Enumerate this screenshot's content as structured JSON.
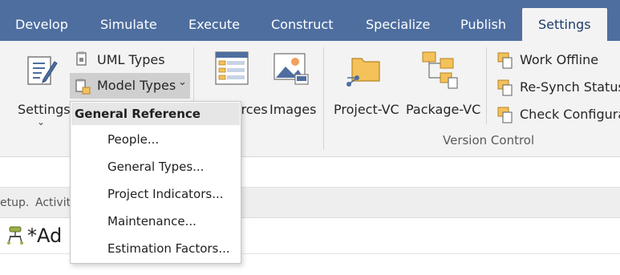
{
  "tabs": [
    {
      "label": "Develop"
    },
    {
      "label": "Simulate"
    },
    {
      "label": "Execute"
    },
    {
      "label": "Construct"
    },
    {
      "label": "Specialize"
    },
    {
      "label": "Publish"
    },
    {
      "label": "Settings",
      "active": true
    }
  ],
  "ribbon": {
    "settings_label": "Settings",
    "uml_types_label": "UML Types",
    "model_types_label": "Model Types",
    "resources_label": "Resources",
    "images_label": "Images",
    "project_vc_label": "Project-VC",
    "package_vc_label": "Package-VC",
    "work_offline_label": "Work Offline",
    "resynch_label": "Re-Synch Status",
    "check_config_label": "Check Configura",
    "version_control_group": "Version Control"
  },
  "breadcrumb": {
    "text1": "etup.",
    "text2": "Activit"
  },
  "document_tab": {
    "title": "*Ad"
  },
  "menu": {
    "header": "General Reference",
    "items": [
      {
        "label": "People..."
      },
      {
        "label": "General Types..."
      },
      {
        "label": "Project Indicators..."
      },
      {
        "label": "Maintenance..."
      },
      {
        "label": "Estimation Factors..."
      }
    ]
  },
  "colors": {
    "tabbar": "#4e6e9f",
    "ribbon": "#f3f3f3",
    "active_tab_text": "#1f3d6b",
    "highlight": "#cfcfcf"
  }
}
